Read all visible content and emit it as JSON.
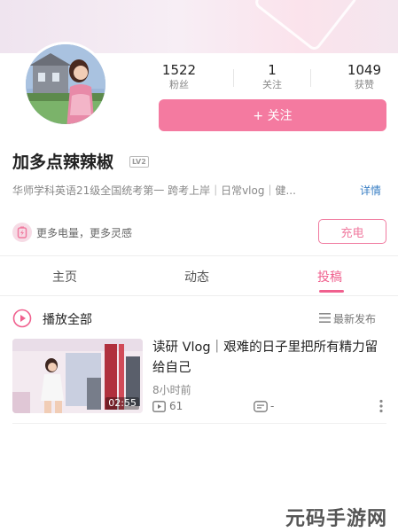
{
  "profile": {
    "name": "加多点辣辣椒",
    "level_badge": "LV2",
    "bio": "华师学科英语21级全国统考第一 跨考上岸｜日常vlog｜健...",
    "bio_more": "详情"
  },
  "stats": [
    {
      "value": "1522",
      "label": "粉丝"
    },
    {
      "value": "1",
      "label": "关注"
    },
    {
      "value": "1049",
      "label": "获赞"
    }
  ],
  "follow_label": "+ 关注",
  "battery": {
    "text": "更多电量，更多灵感",
    "button": "充电"
  },
  "tabs": [
    {
      "label": "主页"
    },
    {
      "label": "动态"
    },
    {
      "label": "投稿"
    }
  ],
  "list_header": {
    "play_all": "播放全部",
    "sort": "最新发布"
  },
  "video": {
    "title": "读研 Vlog｜艰难的日子里把所有精力留给自己",
    "duration": "02:55",
    "time_ago": "8小时前",
    "views": "61",
    "comments": "-"
  },
  "watermark": "元码手游网",
  "colors": {
    "accent": "#f47aa0",
    "tab_active": "#f0608e",
    "link": "#3a7fc4"
  }
}
